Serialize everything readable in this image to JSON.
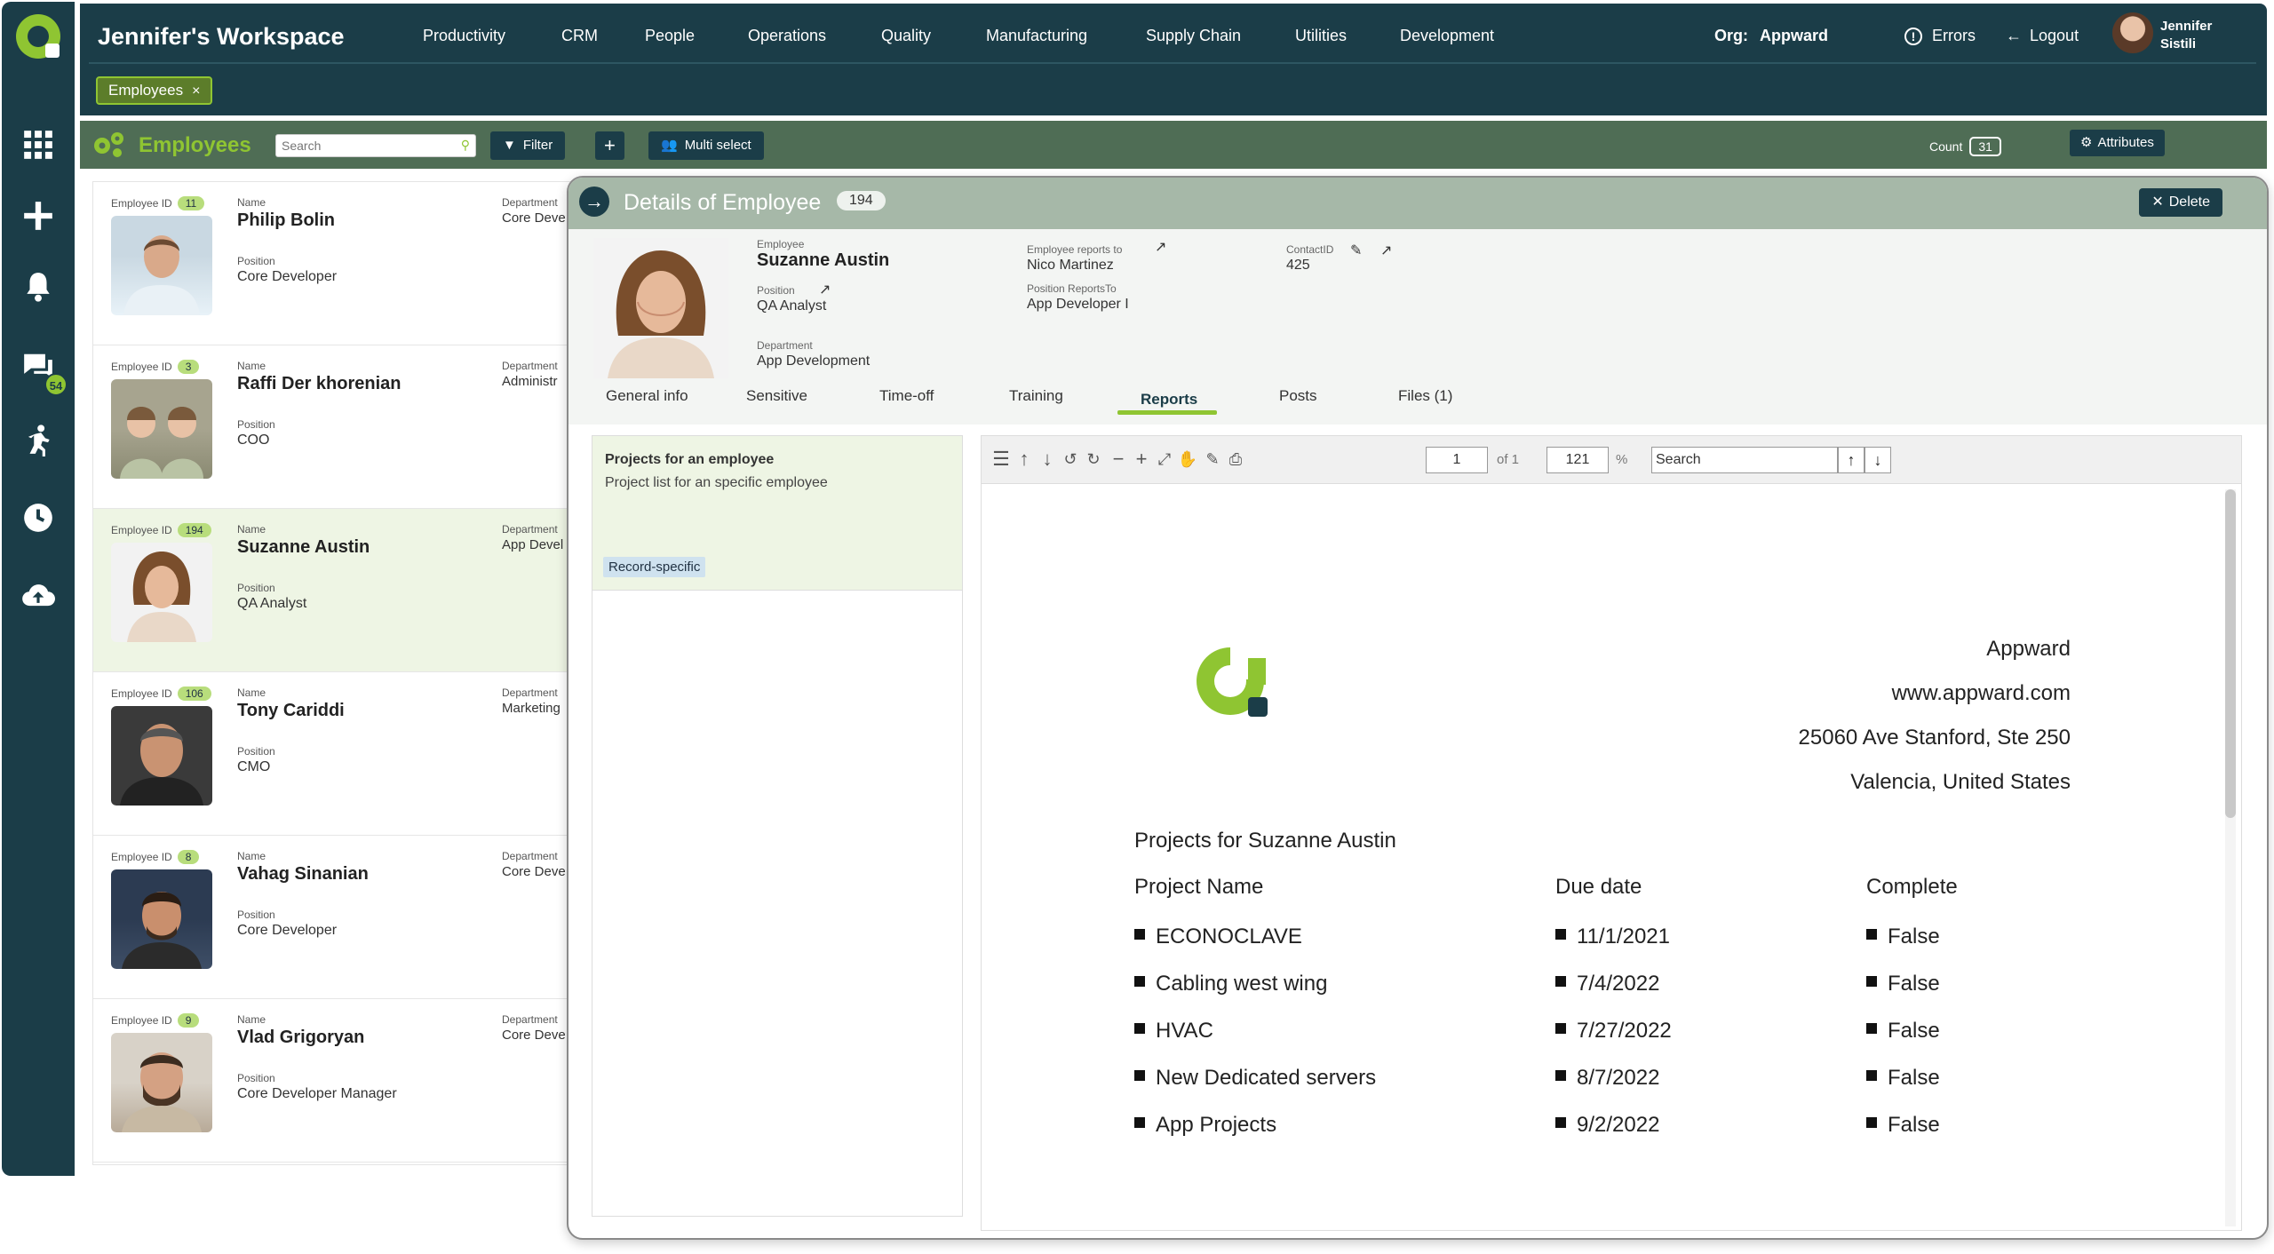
{
  "app": {
    "workspace_title": "Jennifer's Workspace",
    "nav": [
      "Productivity",
      "CRM",
      "People",
      "Operations",
      "Quality",
      "Manufacturing",
      "Supply Chain",
      "Utilities",
      "Development"
    ],
    "org_label": "Org:",
    "org_value": "Appward",
    "errors_label": "Errors",
    "logout_label": "Logout",
    "user_first": "Jennifer",
    "user_last": "Sistili",
    "open_tab": "Employees",
    "chat_badge": "54"
  },
  "toolbar": {
    "title": "Employees",
    "search_placeholder": "Search",
    "filter_label": "Filter",
    "add_label": "+",
    "multi_select_label": "Multi select",
    "count_label": "Count",
    "count_value": "31",
    "attributes_label": "Attributes"
  },
  "list": {
    "id_label": "Employee ID",
    "name_label": "Name",
    "position_label": "Position",
    "department_label": "Department",
    "items": [
      {
        "id": "11",
        "name": "Philip Bolin",
        "position": "Core Developer",
        "department": "Core Deve"
      },
      {
        "id": "3",
        "name": "Raffi Der khorenian",
        "position": "COO",
        "department": "Administr"
      },
      {
        "id": "194",
        "name": "Suzanne Austin",
        "position": "QA Analyst",
        "department": "App Devel"
      },
      {
        "id": "106",
        "name": "Tony Cariddi",
        "position": "CMO",
        "department": "Marketing"
      },
      {
        "id": "8",
        "name": "Vahag Sinanian",
        "position": "Core Developer",
        "department": "Core Deve"
      },
      {
        "id": "9",
        "name": "Vlad Grigoryan",
        "position": "Core Developer Manager",
        "department": "Core Deve"
      }
    ]
  },
  "details": {
    "title": "Details of Employee",
    "id": "194",
    "delete_label": "Delete",
    "employee_label": "Employee",
    "employee_name": "Suzanne Austin",
    "position_label": "Position",
    "position": "QA Analyst",
    "department_label": "Department",
    "department": "App Development",
    "reports_to_label": "Employee reports to",
    "reports_to": "Nico Martinez",
    "position_reports_to_label": "Position ReportsTo",
    "position_reports_to": "App Developer I",
    "contact_label": "ContactID",
    "contact_id": "425",
    "tabs": [
      "General info",
      "Sensitive",
      "Time-off",
      "Training",
      "Reports",
      "Posts",
      "Files (1)"
    ],
    "active_tab": "Reports"
  },
  "reports_list": {
    "title": "Projects for an employee",
    "description": "Project list for an specific employee",
    "tag": "Record-specific"
  },
  "viewer": {
    "page": "1",
    "of_label": "of 1",
    "zoom": "121",
    "pct": "%",
    "search_value": "Search"
  },
  "document": {
    "company": "Appward",
    "website": "www.appward.com",
    "address1": "25060 Ave Stanford, Ste 250",
    "address2": "Valencia, United States",
    "heading": "Projects for Suzanne Austin",
    "columns": [
      "Project Name",
      "Due date",
      "Complete"
    ],
    "rows": [
      [
        "ECONOCLAVE",
        "11/1/2021",
        "False"
      ],
      [
        "Cabling west wing",
        "7/4/2022",
        "False"
      ],
      [
        "HVAC",
        "7/27/2022",
        "False"
      ],
      [
        "New Dedicated servers",
        "8/7/2022",
        "False"
      ],
      [
        "App Projects",
        "9/2/2022",
        "False"
      ]
    ]
  },
  "colors": {
    "brand_green": "#8fc532",
    "dark_teal": "#1b3d48",
    "toolbar_green": "#4f6d55"
  }
}
